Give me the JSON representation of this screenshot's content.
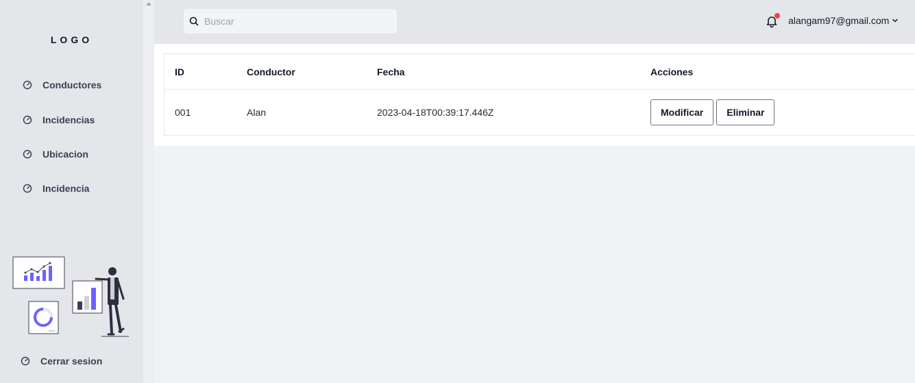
{
  "sidebar": {
    "logo": "LOGO",
    "items": [
      {
        "label": "Conductores"
      },
      {
        "label": "Incidencias"
      },
      {
        "label": "Ubicacion"
      },
      {
        "label": "Incidencia"
      }
    ],
    "logout": "Cerrar sesion"
  },
  "header": {
    "search_placeholder": "Buscar",
    "user_email": "alangam97@gmail.com",
    "notification_dot": "#ef4444"
  },
  "table": {
    "columns": [
      "ID",
      "Conductor",
      "Fecha",
      "Acciones"
    ],
    "rows": [
      {
        "id": "001",
        "conductor": "Alan",
        "fecha": "2023-04-18T00:39:17.446Z",
        "modify_label": "Modificar",
        "delete_label": "Eliminar"
      }
    ]
  },
  "colors": {
    "accent": "#6c63ff",
    "sidebar_bg": "#e5e6ea",
    "content_bg": "#f0f2f6"
  }
}
